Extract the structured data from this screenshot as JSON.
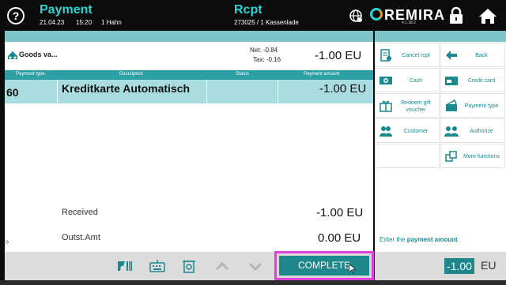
{
  "header": {
    "title": "Payment",
    "date": "21.04.23",
    "time": "15:20",
    "user": "1 Hahn",
    "receipt_title": "Rcpt",
    "receipt_number": "273025 / 1 Kassenlade",
    "logo_text": "REMIRA",
    "logo_version": "4.1.38.2",
    "help_label": "?"
  },
  "goods": {
    "label": "Goods va...",
    "net": "Net: -0.84",
    "tax": "Tax: -0.16",
    "amount": "-1.00 EU"
  },
  "table": {
    "headers": [
      "Payment type",
      "Description",
      "Status",
      "Payment amount"
    ],
    "rows": [
      {
        "type": "60",
        "description": "Kreditkarte Automatisch",
        "status": "",
        "amount": "-1.00 EU"
      }
    ]
  },
  "totals": {
    "received_label": "Received",
    "received_amount": "-1.00 EU",
    "outstanding_label": "Outst.Amt",
    "outstanding_amount": "0.00 EU"
  },
  "toolbar": {
    "complete_label": "COMPLETE"
  },
  "functions": [
    {
      "label": "Cancel rcpt",
      "icon": "cancel-receipt-icon"
    },
    {
      "label": "Back",
      "icon": "back-arrow-icon"
    },
    {
      "label": "Cash",
      "icon": "cash-icon"
    },
    {
      "label": "Credit card",
      "icon": "credit-card-icon"
    },
    {
      "label": "Redeem gift voucher",
      "icon": "gift-icon"
    },
    {
      "label": "Payment type",
      "icon": "payment-type-icon"
    },
    {
      "label": "Customer",
      "icon": "customer-icon"
    },
    {
      "label": "Authorize",
      "icon": "authorize-icon"
    },
    {
      "label": "More functions",
      "icon": "more-functions-icon"
    }
  ],
  "input": {
    "prompt_prefix": "Enter the ",
    "prompt_bold": "payment amount",
    "prompt_suffix": ".",
    "value": "-1.00",
    "currency": "EU"
  },
  "colors": {
    "accent": "#1e878c",
    "header_teal": "#2bd3d3",
    "highlight": "#e23fe0"
  }
}
